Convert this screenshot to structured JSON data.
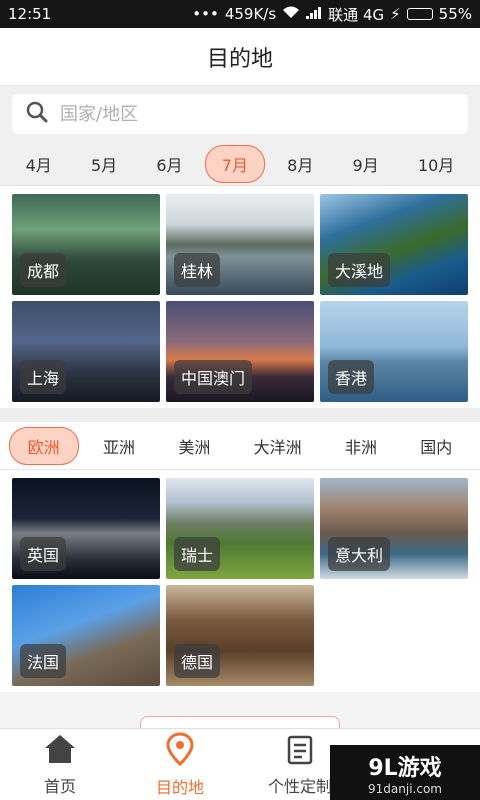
{
  "status": {
    "time": "12:51",
    "dots": "•••",
    "speed": "459K/s",
    "carrier": "联通 4G",
    "battery": "55%",
    "battery_level": 0.55
  },
  "header": {
    "title": "目的地"
  },
  "search": {
    "placeholder": "国家/地区"
  },
  "months": [
    {
      "label": "4月",
      "active": false
    },
    {
      "label": "5月",
      "active": false
    },
    {
      "label": "6月",
      "active": false
    },
    {
      "label": "7月",
      "active": true
    },
    {
      "label": "8月",
      "active": false
    },
    {
      "label": "9月",
      "active": false
    },
    {
      "label": "10月",
      "active": false
    }
  ],
  "month_destinations": [
    "成都",
    "桂林",
    "大溪地",
    "上海",
    "中国澳门",
    "香港"
  ],
  "regions": [
    {
      "label": "欧洲",
      "active": true
    },
    {
      "label": "亚洲",
      "active": false
    },
    {
      "label": "美洲",
      "active": false
    },
    {
      "label": "大洋洲",
      "active": false
    },
    {
      "label": "非洲",
      "active": false
    },
    {
      "label": "国内",
      "active": false
    }
  ],
  "region_destinations": [
    "英国",
    "瑞士",
    "意大利",
    "法国",
    "德国"
  ],
  "bottom_nav": [
    {
      "label": "首页",
      "icon": "home-icon",
      "active": false
    },
    {
      "label": "目的地",
      "icon": "location-pin-icon",
      "active": true
    },
    {
      "label": "个性定制",
      "icon": "clipboard-icon",
      "active": false
    },
    {
      "label": "",
      "icon": "user-icon",
      "active": false
    }
  ],
  "watermark": {
    "big": "9L游戏",
    "small": "91danji.com"
  },
  "colors": {
    "accent": "#f36d2e",
    "pill_bg": "#fdd3c6",
    "status_bg": "#151515"
  }
}
